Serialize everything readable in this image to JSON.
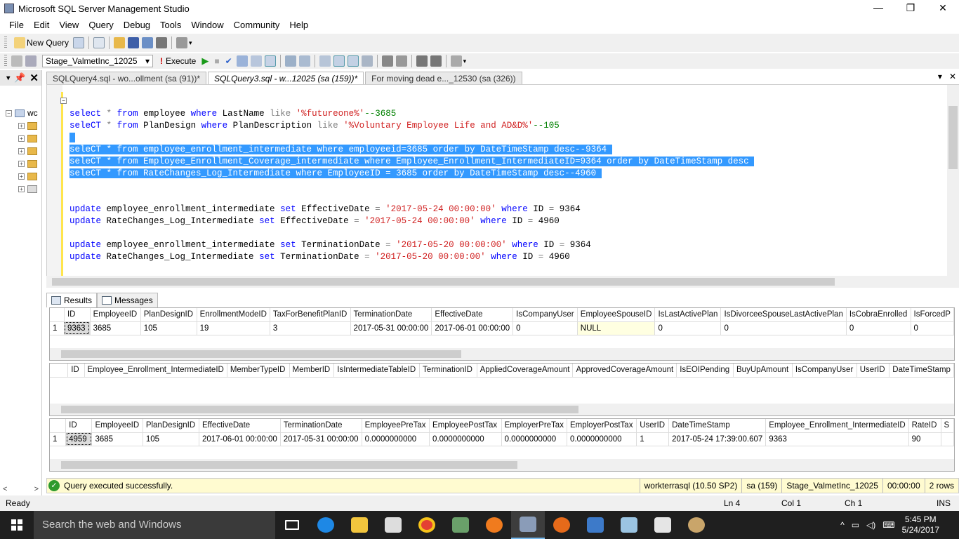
{
  "window": {
    "title": "Microsoft SQL Server Management Studio",
    "minimize": "—",
    "restore": "❐",
    "close": "✕"
  },
  "menu": [
    "File",
    "Edit",
    "View",
    "Query",
    "Debug",
    "Tools",
    "Window",
    "Community",
    "Help"
  ],
  "toolbar1": {
    "new_query": "New Query"
  },
  "toolbar2": {
    "database": "Stage_ValmetInc_12025",
    "execute": "Execute"
  },
  "left_pane": {
    "pin": "📌",
    "close": "✕",
    "root_label": "wc",
    "scroll_left": "<",
    "scroll_right": ">"
  },
  "doc_tabs": [
    {
      "label": "SQLQuery4.sql - wo...ollment (sa (91))*"
    },
    {
      "label": "SQLQuery3.sql - w...12025 (sa (159))*"
    },
    {
      "label": "For moving dead e..._12530 (sa (326))"
    }
  ],
  "doc_tab_controls": {
    "dropdown": "▾",
    "close": "✕"
  },
  "result_tabs": {
    "results": "Results",
    "messages": "Messages"
  },
  "grid1": {
    "columns": [
      "ID",
      "EmployeeID",
      "PlanDesignID",
      "EnrollmentModeID",
      "TaxForBenefitPlanID",
      "TerminationDate",
      "EffectiveDate",
      "IsCompanyUser",
      "EmployeeSpouseID",
      "IsLastActivePlan",
      "IsDivorceeSpouseLastActivePlan",
      "IsCobraEnrolled",
      "IsForcedP"
    ],
    "rows": [
      [
        "1",
        "9363",
        "3685",
        "105",
        "19",
        "3",
        "2017-05-31 00:00:00",
        "2017-06-01 00:00:00",
        "0",
        "NULL",
        "0",
        "0",
        "0",
        "0"
      ]
    ]
  },
  "grid2": {
    "columns": [
      "ID",
      "Employee_Enrollment_IntermediateID",
      "MemberTypeID",
      "MemberID",
      "IsIntermediateTableID",
      "TerminationID",
      "AppliedCoverageAmount",
      "ApprovedCoverageAmount",
      "IsEOIPending",
      "BuyUpAmount",
      "IsCompanyUser",
      "UserID",
      "DateTimeStamp"
    ]
  },
  "grid3": {
    "columns": [
      "ID",
      "EmployeeID",
      "PlanDesignID",
      "EffectiveDate",
      "TerminationDate",
      "EmployeePreTax",
      "EmployeePostTax",
      "EmployerPreTax",
      "EmployerPostTax",
      "UserID",
      "DateTimeStamp",
      "Employee_Enrollment_IntermediateID",
      "RateID",
      "S"
    ],
    "rows": [
      [
        "1",
        "4959",
        "3685",
        "105",
        "2017-06-01 00:00:00",
        "2017-05-31 00:00:00",
        "0.0000000000",
        "0.0000000000",
        "0.0000000000",
        "0.0000000000",
        "1",
        "2017-05-24 17:39:00.607",
        "9363",
        "90",
        ""
      ]
    ]
  },
  "query_status": {
    "message": "Query executed successfully.",
    "server": "workterrasql (10.50 SP2)",
    "user": "sa (159)",
    "database": "Stage_ValmetInc_12025",
    "elapsed": "00:00:00",
    "rows": "2 rows"
  },
  "status_bar": {
    "ready": "Ready",
    "ln": "Ln 4",
    "col": "Col 1",
    "ch": "Ch 1",
    "ins": "INS"
  },
  "taskbar": {
    "search_placeholder": "Search the web and Windows",
    "time": "5:45 PM",
    "date": "5/24/2017"
  },
  "colors": {
    "selection": "#3399ff",
    "keyword": "#0000ff",
    "string": "#d02020",
    "comment": "#008000",
    "status_ok": "#2e9b2e"
  }
}
